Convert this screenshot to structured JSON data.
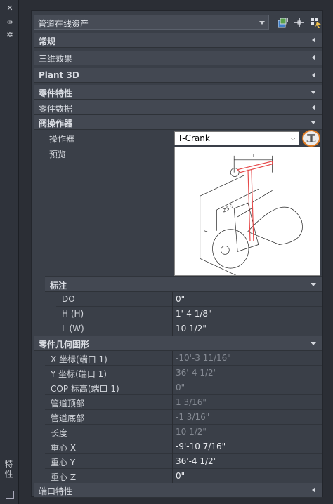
{
  "strip": {
    "controls": [
      "✕",
      "⇹",
      "✲"
    ],
    "title": "特性"
  },
  "top": {
    "dropdown_value": "管道在线资产"
  },
  "sections": {
    "general": "常规",
    "3d": "三维效果",
    "plant3d": "Plant 3D",
    "part_props": "零件特性",
    "part_data": "零件数据",
    "valve_operator": "阀操作器",
    "dims": "标注",
    "part_geometry": "零件几何图形",
    "port_props": "端口特性"
  },
  "valve_operator": {
    "operator_label": "操作器",
    "operator_value": "T-Crank",
    "preview_label": "预览"
  },
  "dims": [
    {
      "key": "DO",
      "value": "0\""
    },
    {
      "key": "H (H)",
      "value": "1'-4 1/8\""
    },
    {
      "key": "L (W)",
      "value": "10 1/2\""
    }
  ],
  "geometry": [
    {
      "key": "X 坐标(端口 1)",
      "value": "-10'-3 11/16\"",
      "dim": true
    },
    {
      "key": "Y 坐标(端口 1)",
      "value": "36'-4 1/2\"",
      "dim": true
    },
    {
      "key": "COP 标高(端口 1)",
      "value": "0\"",
      "dim": true
    },
    {
      "key": "管道顶部",
      "value": "1 3/16\"",
      "dim": true
    },
    {
      "key": "管道底部",
      "value": "-1 3/16\"",
      "dim": true
    },
    {
      "key": "长度",
      "value": "10 1/2\"",
      "dim": true
    },
    {
      "key": "重心 X",
      "value": "-9'-10 7/16\"",
      "dim": false
    },
    {
      "key": "重心 Y",
      "value": "36'-4 1/2\"",
      "dim": false
    },
    {
      "key": "重心 Z",
      "value": "0\"",
      "dim": false
    }
  ]
}
